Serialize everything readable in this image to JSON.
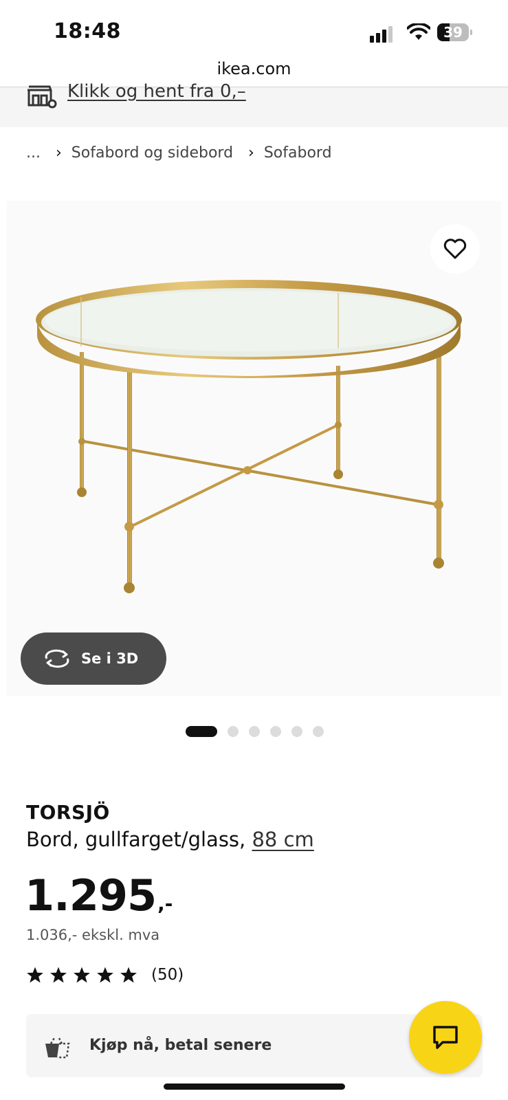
{
  "status_bar": {
    "time": "18:48",
    "battery": "39",
    "battery_level": 0.39
  },
  "browser": {
    "url": "ikea.com"
  },
  "banner": {
    "link_text": "Klikk og hent fra 0,–",
    "icon": "store-pickup-icon"
  },
  "breadcrumb": {
    "items": [
      "...",
      "Sofabord og sidebord",
      "Sofabord"
    ],
    "separator": "›"
  },
  "gallery": {
    "view_3d_label": "Se i 3D",
    "dot_count": 6,
    "active_dot": 0,
    "icons": {
      "favorite": "heart-icon",
      "view3d": "rotate-3d-icon"
    }
  },
  "product": {
    "name": "TORSJÖ",
    "description": "Bord, gullfarget/glass,",
    "size_link": "88 cm",
    "price_main": "1.295",
    "price_suffix": ",-",
    "price_ex_vat": "1.036,- ekskl. mva",
    "rating": {
      "stars": 5,
      "count": "(50)"
    }
  },
  "bnpl": {
    "label": "Kjøp nå, betal senere",
    "icon": "basket-icon"
  },
  "chat": {
    "icon": "chat-icon"
  },
  "colors": {
    "accent_yellow": "#f8d417",
    "button_dark": "#4b4b4b",
    "banner_bg": "#f5f5f5",
    "gold": "#c8a24a"
  }
}
